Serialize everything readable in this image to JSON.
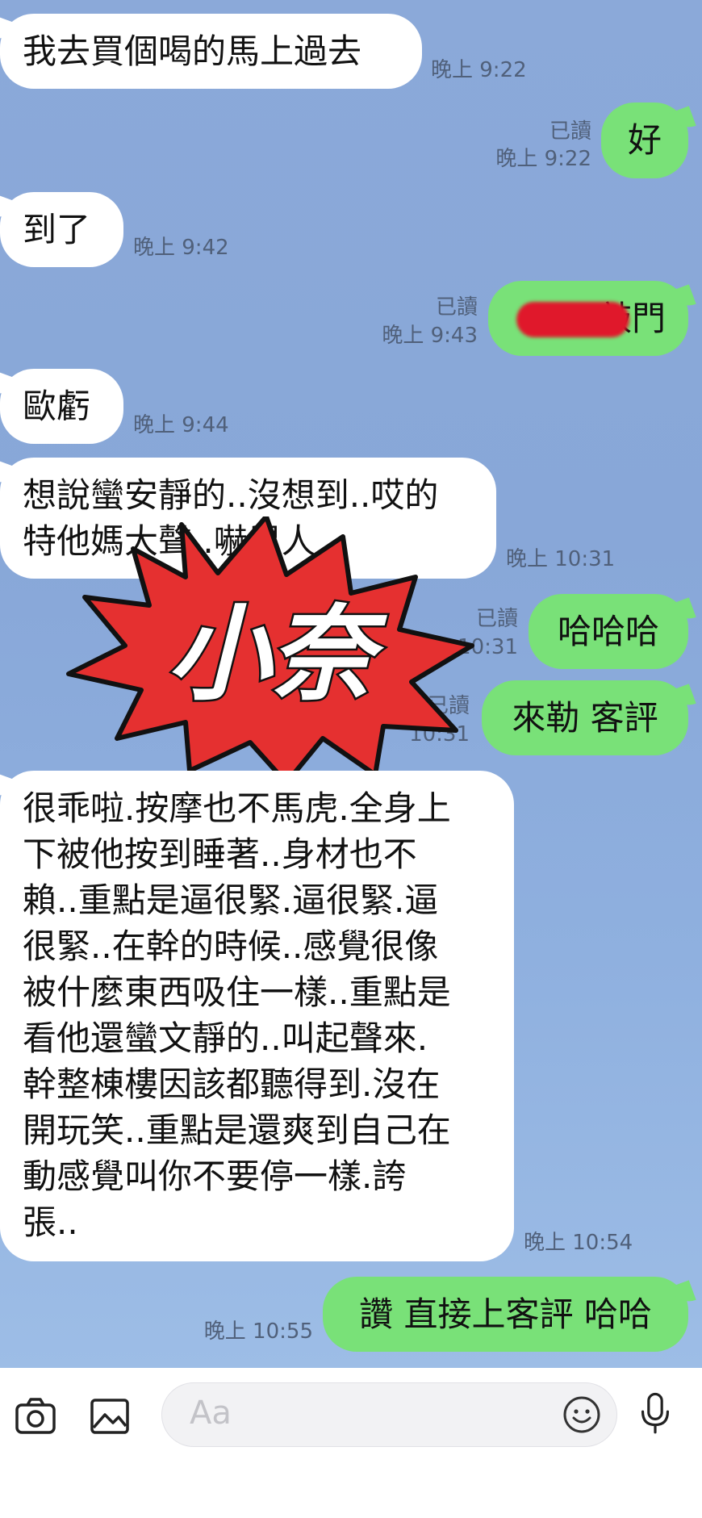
{
  "messages": [
    {
      "side": "in",
      "text": "我去買個喝的馬上過去",
      "time": "晚上 9:22"
    },
    {
      "side": "out",
      "text": "好",
      "read": "已讀",
      "time": "晚上 9:22"
    },
    {
      "side": "in",
      "text": "到了",
      "time": "晚上 9:42"
    },
    {
      "side": "out",
      "text": "敲門",
      "read": "已讀",
      "time": "晚上 9:43"
    },
    {
      "side": "in",
      "text": "歐虧",
      "time": "晚上 9:44"
    },
    {
      "side": "in",
      "text": "想說蠻安靜的..沒想到..哎的\n特他媽大聲..嚇鼠人",
      "time": "晚上 10:31"
    },
    {
      "side": "out",
      "text": "哈哈哈",
      "read": "已讀",
      "time": "晚上 10:31"
    },
    {
      "side": "out",
      "text": "來勒 客評",
      "read": "已讀",
      "time": "10:31"
    },
    {
      "side": "in",
      "text": "很乖啦.按摩也不馬虎.全身上\n下被他按到睡著..身材也不\n賴..重點是逼很緊.逼很緊.逼\n很緊..在幹的時候..感覺很像\n被什麼東西吸住一樣..重點是\n看他還蠻文靜的..叫起聲來.\n幹整棟樓因該都聽得到.沒在\n開玩笑..重點是還爽到自己在\n動感覺叫你不要停一樣.誇\n張..",
      "time": "晚上 10:54"
    },
    {
      "side": "out",
      "text": "讚 直接上客評 哈哈",
      "time": "晚上 10:55"
    }
  ],
  "sticker": {
    "text": "小奈",
    "fill": "#e53030"
  },
  "input_bar": {
    "placeholder": "Aa",
    "icons": [
      "camera-icon",
      "image-icon",
      "emoji-icon",
      "microphone-icon"
    ]
  },
  "colors": {
    "incoming": "#ffffff",
    "outgoing": "#79e178",
    "background": "#8aa8d8"
  }
}
